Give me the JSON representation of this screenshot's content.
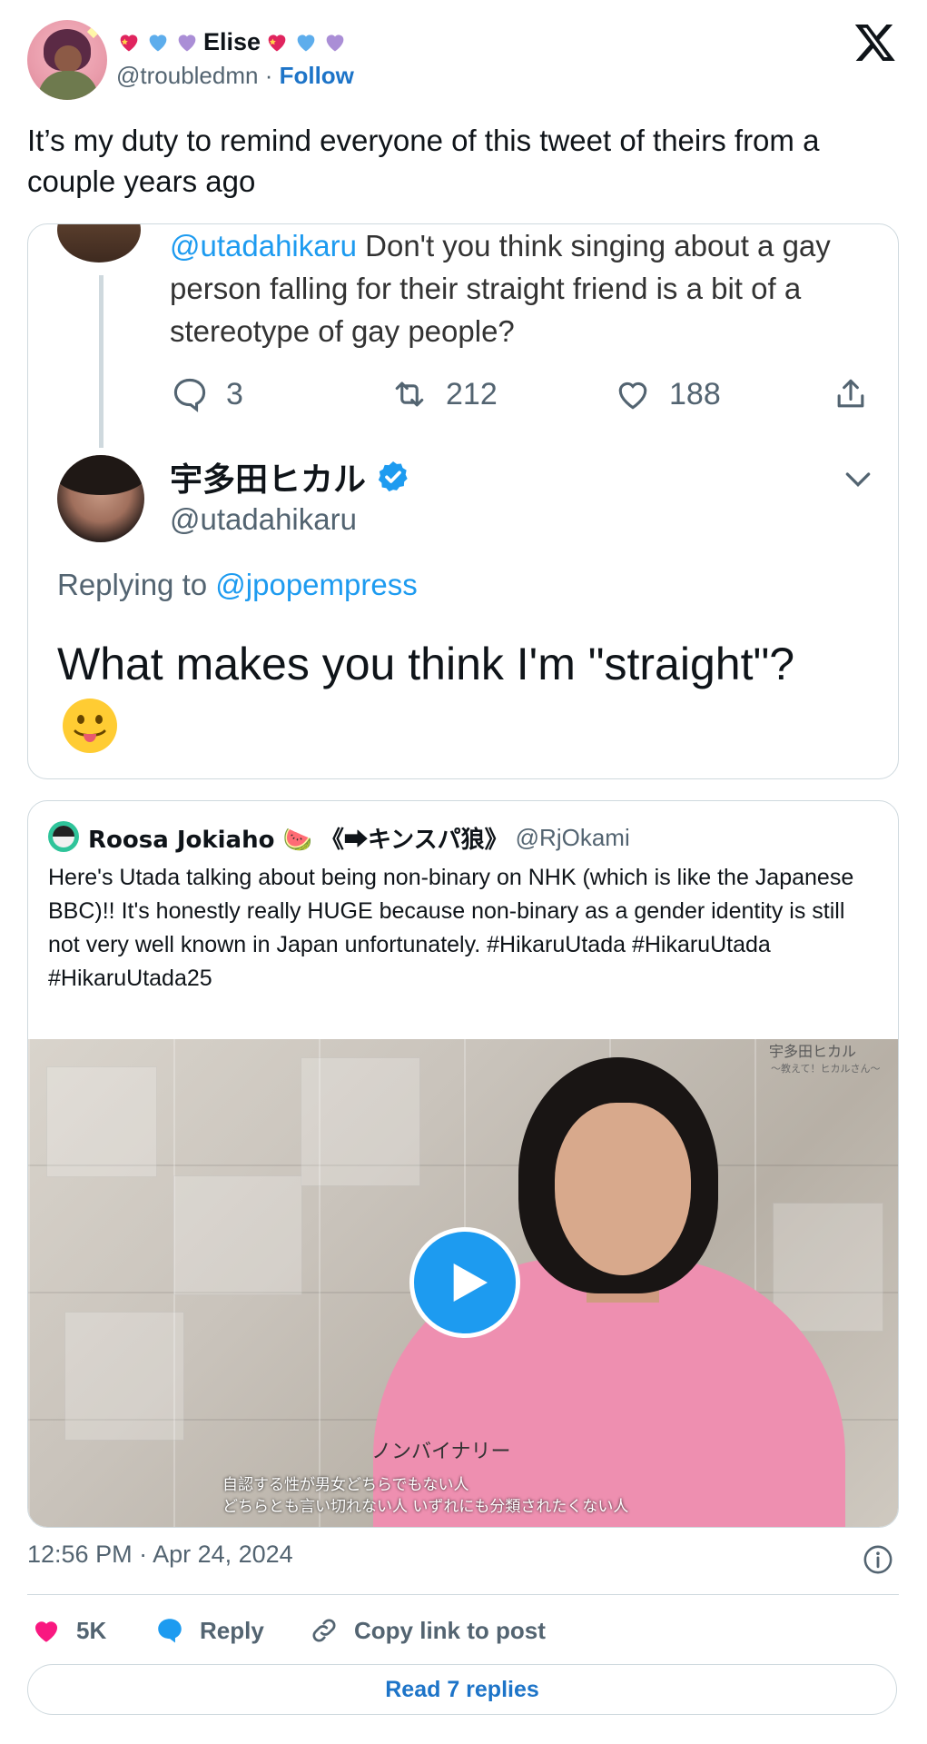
{
  "author": {
    "name_emoji_prefix": [
      "heart-sparkle-red",
      "heart-blue",
      "heart-purple"
    ],
    "display_name": "Elise",
    "name_emoji_suffix": [
      "heart-sparkle-red",
      "heart-blue",
      "heart-purple"
    ],
    "handle": "@troubledmn",
    "separator": " · ",
    "follow_label": "Follow"
  },
  "brand_icon": "x-logo-icon",
  "tweet_text": "It’s my duty to remind everyone of this tweet of theirs from a couple years ago",
  "embedded_screenshot": {
    "reply_mention": "@utadahikaru",
    "reply_body": " Don't you think singing about a gay person falling for their straight friend is a bit of a stereotype of gay people?",
    "stats": {
      "replies": "3",
      "retweets": "212",
      "likes": "188"
    },
    "responder_name": "宇多田ヒカル",
    "responder_handle": "@utadahikaru",
    "replying_to_label": "Replying to",
    "replying_to_handle": "@jpopempress",
    "response_text": "What makes you think I'm \"straight\"?",
    "response_emoji": "tongue-face"
  },
  "quoted_tweet": {
    "name": "Roosa Jokiaho 🍉 《⮕キンスパ狼》",
    "handle": "@RjOkami",
    "text": "Here's Utada talking about being non-binary on NHK (which is like the Japanese BBC)!! It's honestly really HUGE because non-binary as a gender identity is still not very well known in Japan unfortunately. #HikaruUtada #HikaruUtada #HikaruUtada25",
    "video": {
      "corner_title": "宇多田ヒカル",
      "corner_subtitle": "～教えて！ヒカルさん～",
      "subtitle_heading": "ノンバイナリー",
      "subtitle_line1": "自認する性が男女どちらでもない人",
      "subtitle_line2": "どちらとも言い切れない人 いずれにも分類されたくない人",
      "play_icon": "play-icon"
    }
  },
  "timestamp": "12:56 PM · Apr 24, 2024",
  "footer": {
    "like_count": "5K",
    "reply_label": "Reply",
    "copy_label": "Copy link to post",
    "read_replies_label": "Read 7 replies"
  },
  "colors": {
    "accent": "#1d9bf0",
    "link": "#1d74c8",
    "like": "#f91880",
    "muted": "#536471",
    "border": "#cfd9de"
  }
}
